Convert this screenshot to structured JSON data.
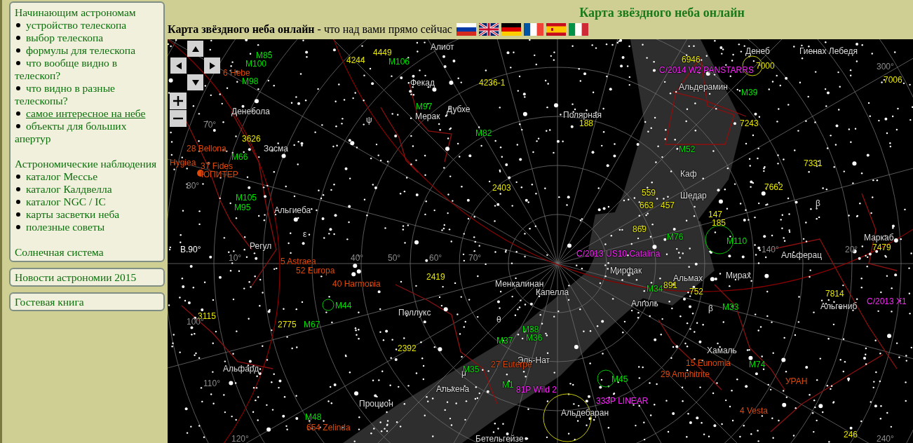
{
  "sidebar": {
    "sections": [
      {
        "heading": "Начинающим астрономам",
        "items": [
          {
            "label": "устройство телескопа",
            "underlined": false
          },
          {
            "label": "выбор телескопа",
            "underlined": false
          },
          {
            "label": "формулы для телескопа",
            "underlined": false
          },
          {
            "label": "что вообще видно в телескоп?",
            "underlined": false
          },
          {
            "label": "что видно в разные телескопы?",
            "underlined": false
          },
          {
            "label": "самое интересное на небе",
            "underlined": true
          },
          {
            "label": "объекты для больших апертур",
            "underlined": false
          }
        ]
      },
      {
        "heading": "Астрономические наблюдения",
        "items": [
          {
            "label": "каталог Мессье",
            "underlined": false
          },
          {
            "label": "каталог Калдвелла",
            "underlined": false
          },
          {
            "label": "каталог NGC / IC",
            "underlined": false
          },
          {
            "label": "карты засветки неба",
            "underlined": false
          },
          {
            "label": "полезные советы",
            "underlined": false
          }
        ]
      },
      {
        "heading": "Солнечная система"
      }
    ],
    "boxes": [
      "Новости астрономии 2015",
      "Гостевая книга"
    ]
  },
  "page_title": "Карта звёздного неба онлайн",
  "subtitle": "**Карта звёздного неба онлайн** - что над вами прямо сейчас",
  "flags": [
    {
      "kind": "ru"
    },
    {
      "kind": "gb"
    },
    {
      "kind": "de"
    },
    {
      "kind": "fr"
    },
    {
      "kind": "es"
    },
    {
      "kind": "it"
    }
  ],
  "map_labels": [
    {
      "text": "Алиот",
      "kind": "star"
    },
    {
      "text": "Денебола",
      "kind": "star"
    },
    {
      "text": "Фекад",
      "kind": "star"
    },
    {
      "text": "Мерак",
      "kind": "star"
    },
    {
      "text": "Дубхе",
      "kind": "star"
    },
    {
      "text": "Зосма",
      "kind": "star"
    },
    {
      "text": "Альгиеба",
      "kind": "star"
    },
    {
      "text": "Регул",
      "kind": "star"
    },
    {
      "text": "Полярная",
      "kind": "star"
    },
    {
      "text": "Денеб",
      "kind": "star"
    },
    {
      "text": "Гиенах Лебедя",
      "kind": "star"
    },
    {
      "text": "Альдерамин",
      "kind": "star"
    },
    {
      "text": "Каф",
      "kind": "star"
    },
    {
      "text": "Шедар",
      "kind": "star"
    },
    {
      "text": "Маркаб",
      "kind": "star"
    },
    {
      "text": "Альферац",
      "kind": "star"
    },
    {
      "text": "Мирфак",
      "kind": "star"
    },
    {
      "text": "Альмах",
      "kind": "star"
    },
    {
      "text": "Мирах",
      "kind": "star"
    },
    {
      "text": "Алголь",
      "kind": "star"
    },
    {
      "text": "Альгениб",
      "kind": "star"
    },
    {
      "text": "Менкалинан",
      "kind": "star"
    },
    {
      "text": "Капелла",
      "kind": "star"
    },
    {
      "text": "Поллукс",
      "kind": "star"
    },
    {
      "text": "Альфард",
      "kind": "star"
    },
    {
      "text": "Альхена",
      "kind": "star"
    },
    {
      "text": "Процион",
      "kind": "star"
    },
    {
      "text": "Эль-Нат",
      "kind": "star"
    },
    {
      "text": "Хамаль",
      "kind": "star"
    },
    {
      "text": "Альдебаран",
      "kind": "star"
    },
    {
      "text": "Бетельгейзе",
      "kind": "star"
    },
    {
      "text": "ψ",
      "kind": "star"
    },
    {
      "text": "ε",
      "kind": "star"
    },
    {
      "text": "θ",
      "kind": "star"
    },
    {
      "text": "β",
      "kind": "star"
    },
    {
      "text": "β",
      "kind": "star"
    },
    {
      "text": "μ",
      "kind": "star"
    },
    {
      "text": "M106",
      "kind": "messier"
    },
    {
      "text": "M97",
      "kind": "messier"
    },
    {
      "text": "M82",
      "kind": "messier"
    },
    {
      "text": "M66",
      "kind": "messier"
    },
    {
      "text": "M105",
      "kind": "messier"
    },
    {
      "text": "M95",
      "kind": "messier"
    },
    {
      "text": "M44",
      "kind": "messier"
    },
    {
      "text": "M67",
      "kind": "messier"
    },
    {
      "text": "M38",
      "kind": "messier"
    },
    {
      "text": "M36",
      "kind": "messier"
    },
    {
      "text": "M37",
      "kind": "messier"
    },
    {
      "text": "M35",
      "kind": "messier"
    },
    {
      "text": "M1",
      "kind": "messier"
    },
    {
      "text": "M45",
      "kind": "messier"
    },
    {
      "text": "M48",
      "kind": "messier"
    },
    {
      "text": "M39",
      "kind": "messier"
    },
    {
      "text": "M52",
      "kind": "messier"
    },
    {
      "text": "M76",
      "kind": "messier"
    },
    {
      "text": "M110",
      "kind": "messier"
    },
    {
      "text": "M34",
      "kind": "messier"
    },
    {
      "text": "M33",
      "kind": "messier"
    },
    {
      "text": "M74",
      "kind": "messier"
    },
    {
      "text": "M85",
      "kind": "messier"
    },
    {
      "text": "M100",
      "kind": "messier"
    },
    {
      "text": "M98",
      "kind": "messier"
    },
    {
      "text": "4449",
      "kind": "ngc"
    },
    {
      "text": "4244",
      "kind": "ngc"
    },
    {
      "text": "4236-1",
      "kind": "ngc"
    },
    {
      "text": "3626",
      "kind": "ngc"
    },
    {
      "text": "2403",
      "kind": "ngc"
    },
    {
      "text": "188",
      "kind": "ngc"
    },
    {
      "text": "6946",
      "kind": "ngc"
    },
    {
      "text": "7000",
      "kind": "ngc"
    },
    {
      "text": "7006",
      "kind": "ngc"
    },
    {
      "text": "7243",
      "kind": "ngc"
    },
    {
      "text": "7331",
      "kind": "ngc"
    },
    {
      "text": "7662",
      "kind": "ngc"
    },
    {
      "text": "559",
      "kind": "ngc"
    },
    {
      "text": "663",
      "kind": "ngc"
    },
    {
      "text": "457",
      "kind": "ngc"
    },
    {
      "text": "147",
      "kind": "ngc"
    },
    {
      "text": "185",
      "kind": "ngc"
    },
    {
      "text": "869",
      "kind": "ngc"
    },
    {
      "text": "7479",
      "kind": "ngc"
    },
    {
      "text": "2419",
      "kind": "ngc"
    },
    {
      "text": "3115",
      "kind": "ngc"
    },
    {
      "text": "2775",
      "kind": "ngc"
    },
    {
      "text": "2392",
      "kind": "ngc"
    },
    {
      "text": "891",
      "kind": "ngc"
    },
    {
      "text": "752",
      "kind": "ngc"
    },
    {
      "text": "7814",
      "kind": "ngc"
    },
    {
      "text": "246",
      "kind": "ngc"
    },
    {
      "text": "C/2014 W2 PANSTARRS",
      "kind": "comet"
    },
    {
      "text": "C/2013 US10 Catalina",
      "kind": "comet"
    },
    {
      "text": "C/2013 X1",
      "kind": "comet"
    },
    {
      "text": "333P LINEAR",
      "kind": "comet"
    },
    {
      "text": "81P Wild 2",
      "kind": "comet"
    },
    {
      "text": "6 Hebe",
      "kind": "asteroid"
    },
    {
      "text": "28 Bellona",
      "kind": "asteroid"
    },
    {
      "text": "Hygiea",
      "kind": "asteroid"
    },
    {
      "text": "37 Fides",
      "kind": "asteroid"
    },
    {
      "text": "ЮПИТЕР",
      "kind": "asteroid"
    },
    {
      "text": "5 Astraea",
      "kind": "asteroid"
    },
    {
      "text": "52 Europa",
      "kind": "asteroid"
    },
    {
      "text": "40 Harmonia",
      "kind": "asteroid"
    },
    {
      "text": "27 Euterpe",
      "kind": "asteroid"
    },
    {
      "text": "15 Eunomia",
      "kind": "asteroid"
    },
    {
      "text": "29 Amphitrite",
      "kind": "asteroid"
    },
    {
      "text": "УРАН",
      "kind": "asteroid"
    },
    {
      "text": "4 Vesta",
      "kind": "asteroid"
    },
    {
      "text": "654 Zelinda",
      "kind": "asteroid"
    },
    {
      "text": "300°",
      "kind": "grid"
    },
    {
      "text": "70°",
      "kind": "grid"
    },
    {
      "text": "80°",
      "kind": "grid"
    },
    {
      "text": "B.90°",
      "kind": "axis"
    },
    {
      "text": "140°",
      "kind": "grid"
    },
    {
      "text": "20°",
      "kind": "grid"
    },
    {
      "text": "10°",
      "kind": "grid"
    },
    {
      "text": "40°",
      "kind": "grid"
    },
    {
      "text": "50°",
      "kind": "grid"
    },
    {
      "text": "60°",
      "kind": "grid"
    },
    {
      "text": "70°",
      "kind": "grid"
    },
    {
      "text": "100°",
      "kind": "grid"
    },
    {
      "text": "110°",
      "kind": "grid"
    },
    {
      "text": "120°",
      "kind": "grid"
    },
    {
      "text": "240°",
      "kind": "grid"
    }
  ]
}
